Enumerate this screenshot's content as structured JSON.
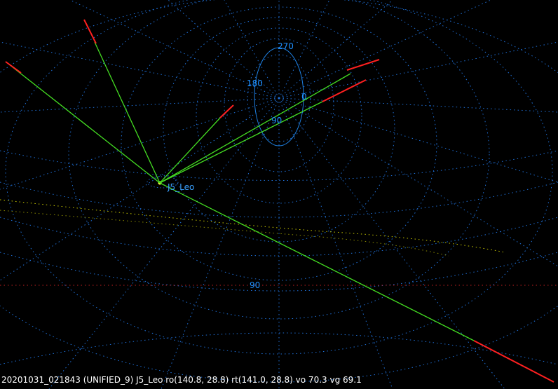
{
  "status_line": "20201031_021843 (UNIFIED_9) J5_Leo ro(140.8, 28.8) rt(141.0, 28.8) vo 70.3 vg 69.1",
  "radiant": {
    "name": "J5_Leo"
  },
  "sky_labels": {
    "az_270": "270",
    "az_180": "180",
    "az_0": "0",
    "az_90": "90",
    "alt_90": "90"
  },
  "colors": {
    "background": "#000000",
    "grid": "#1f6fd6",
    "label": "#1e90ff",
    "meteor_observed": "#ff2020",
    "meteor_projection": "#44dd22",
    "ecliptic": "#c8c800",
    "horizon": "#c02020",
    "status_text": "#ffffff"
  },
  "icons": [
    "radiant-marker-icon"
  ]
}
